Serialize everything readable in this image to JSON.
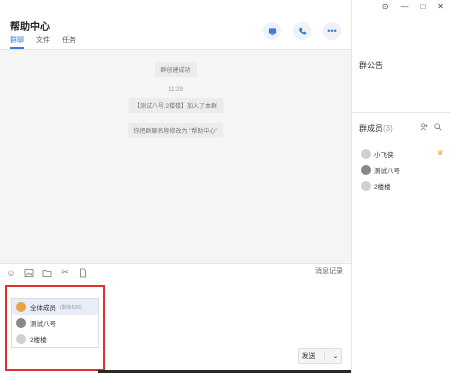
{
  "header": {
    "title": "帮助中心",
    "tabs": [
      "群聊",
      "文件",
      "任务"
    ],
    "active_tab": 0
  },
  "messages": [
    {
      "text": "群创建成功",
      "kind": "system"
    },
    {
      "text": "11:29",
      "kind": "time"
    },
    {
      "text": "【测试八号,2楼楼】加入了本群",
      "kind": "system"
    },
    {
      "text": "你把群聊名称修改为 \"帮助中心\"",
      "kind": "system"
    }
  ],
  "toolbar": {
    "icons": [
      "emoji-icon",
      "image-icon",
      "folder-icon",
      "scissors-icon",
      "file-icon"
    ],
    "history_label": "消息记录"
  },
  "input": {
    "value": "@"
  },
  "mention_list": [
    {
      "name": "全体成员",
      "sub": "(剩余520)",
      "avatar": "group"
    },
    {
      "name": "测试八号",
      "sub": "",
      "avatar": "dark"
    },
    {
      "name": "2楼楼",
      "sub": "",
      "avatar": "person"
    }
  ],
  "send_label": "发送",
  "right_panel": {
    "notice_title": "群公告",
    "members_title": "群成员",
    "members_count": "(3)",
    "members": [
      {
        "name": "小飞侠",
        "avatar": "person"
      },
      {
        "name": "测试八号",
        "avatar": "dark"
      },
      {
        "name": "2楼楼",
        "avatar": "person"
      }
    ]
  },
  "colors": {
    "accent": "#3a7bd5",
    "highlight_border": "#e03131",
    "owner_badge": "#f0a020"
  }
}
